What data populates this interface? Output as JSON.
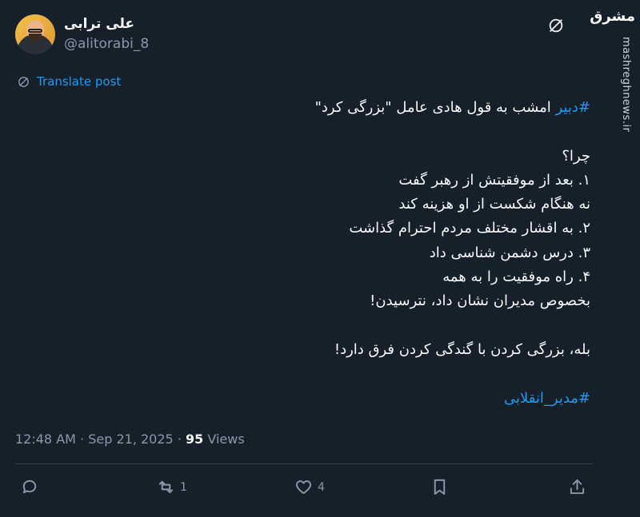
{
  "author": {
    "display_name": "علی ترابی",
    "handle": "@alitorabi_8"
  },
  "translate_label": "Translate post",
  "body": {
    "line1_tag": "#دبیر",
    "line1_text": " امشب به قول هادی عامل \"بزرگی کرد\"",
    "lines": [
      "",
      "چرا؟",
      "۱. بعد از موفقیتش از رهبر گفت",
      "نه هنگام شکست از او هزینه کند",
      "۲. به اقشار مختلف مردم احترام گذاشت",
      "۳. درس دشمن شناسی داد",
      "۴. راه موفقیت را به همه",
      "بخصوص مدیران نشان داد، نترسیدن!",
      "",
      "بله، بزرگی کردن با گندگی کردن فرق دارد!",
      ""
    ],
    "final_tag": "#مدیر_انقلابی"
  },
  "meta": {
    "time": "12:48 AM",
    "date": "Sep 21, 2025",
    "views_count": "95",
    "views_label": "Views"
  },
  "actions": {
    "reply_count": "",
    "retweet_count": "1",
    "like_count": "4"
  },
  "watermark": {
    "brand": "مشرق",
    "site": "mashreghnews.ir"
  },
  "colors": {
    "background": "#15202b",
    "accent": "#1d9bf0",
    "secondary_text": "#8b98a5"
  }
}
